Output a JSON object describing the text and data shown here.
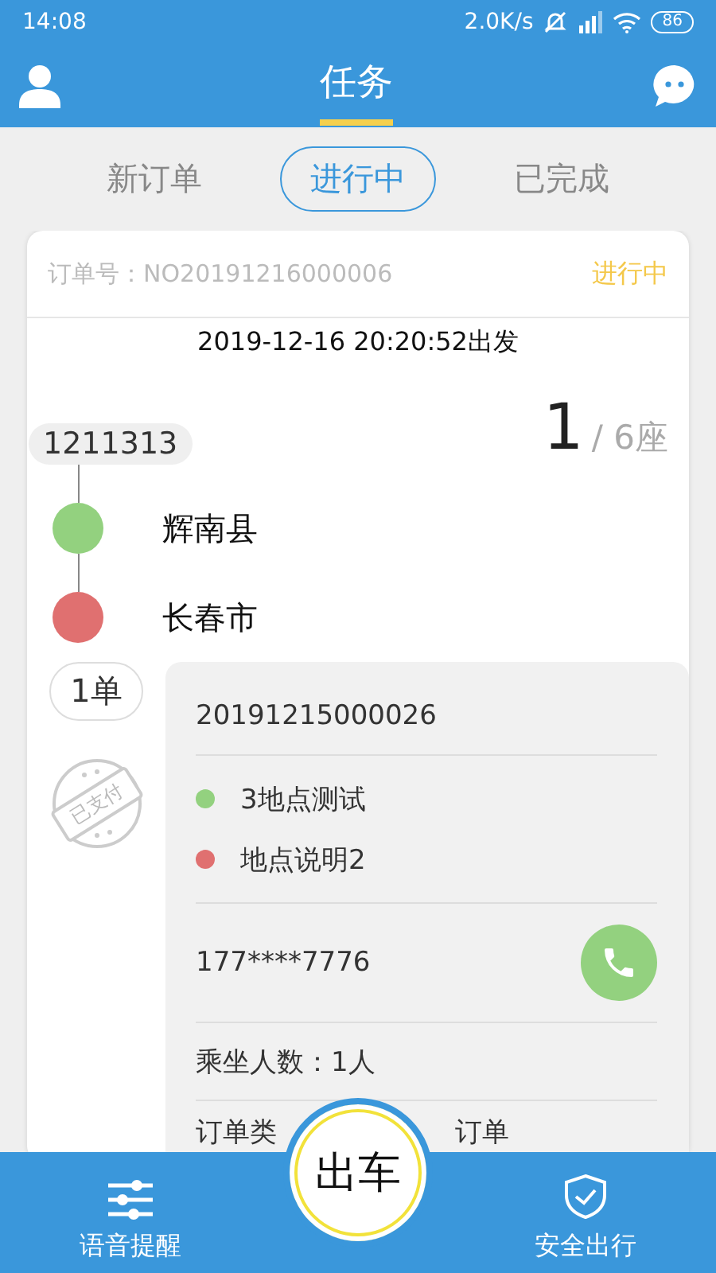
{
  "status_bar": {
    "time": "14:08",
    "net_speed": "2.0K/s",
    "battery": "86"
  },
  "header": {
    "title": "任务"
  },
  "tabs": [
    {
      "label": "新订单",
      "selected": false
    },
    {
      "label": "进行中",
      "selected": true
    },
    {
      "label": "已完成",
      "selected": false
    }
  ],
  "order": {
    "number": "订单号：NO20191216000006",
    "status": "进行中",
    "departure": "2019-12-16 20:20:52出发",
    "route_code": "1211313",
    "seats_taken": "1",
    "seats_total": "/ 6座",
    "stops": [
      {
        "name": "辉南县",
        "color": "#93d17f"
      },
      {
        "name": "长春市",
        "color": "#e07070"
      }
    ],
    "order_count": "1单",
    "paid_stamp": "已支付",
    "sub_order": {
      "number": "20191215000026",
      "places": [
        {
          "name": "3地点测试",
          "color": "#93d17f"
        },
        {
          "name": "地点说明2",
          "color": "#e07070"
        }
      ],
      "phone": "177****7776",
      "passengers": "乘坐人数：1人",
      "order_type_start": "订单类",
      "order_type_end": "订单"
    }
  },
  "bottom_bar": {
    "left": "语音提醒",
    "center": "出车",
    "right": "安全出行"
  }
}
